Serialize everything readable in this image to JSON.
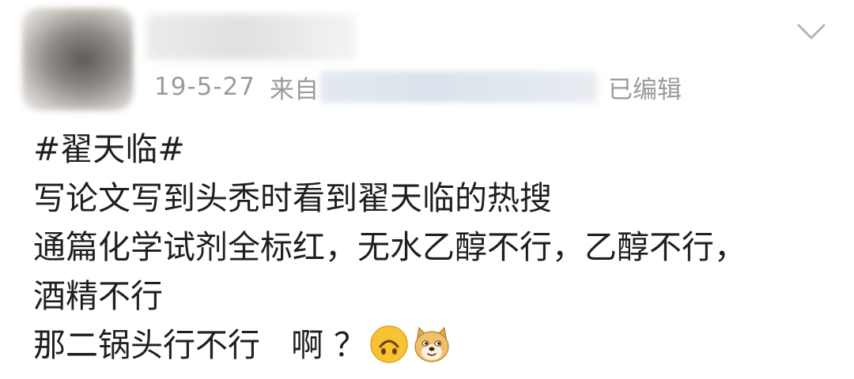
{
  "post": {
    "meta": {
      "date": "19-5-27",
      "source_prefix": "来自",
      "edited_label": "已编辑"
    },
    "lines": [
      "#翟天临#",
      "写论文写到头秃时看到翟天临的热搜",
      "通篇化学试剂全标红，无水乙醇不行，乙醇不行，",
      "酒精不行",
      "那二锅头行不行   啊 ？"
    ],
    "emojis": [
      "upside-down-face-icon",
      "doge-icon"
    ]
  }
}
